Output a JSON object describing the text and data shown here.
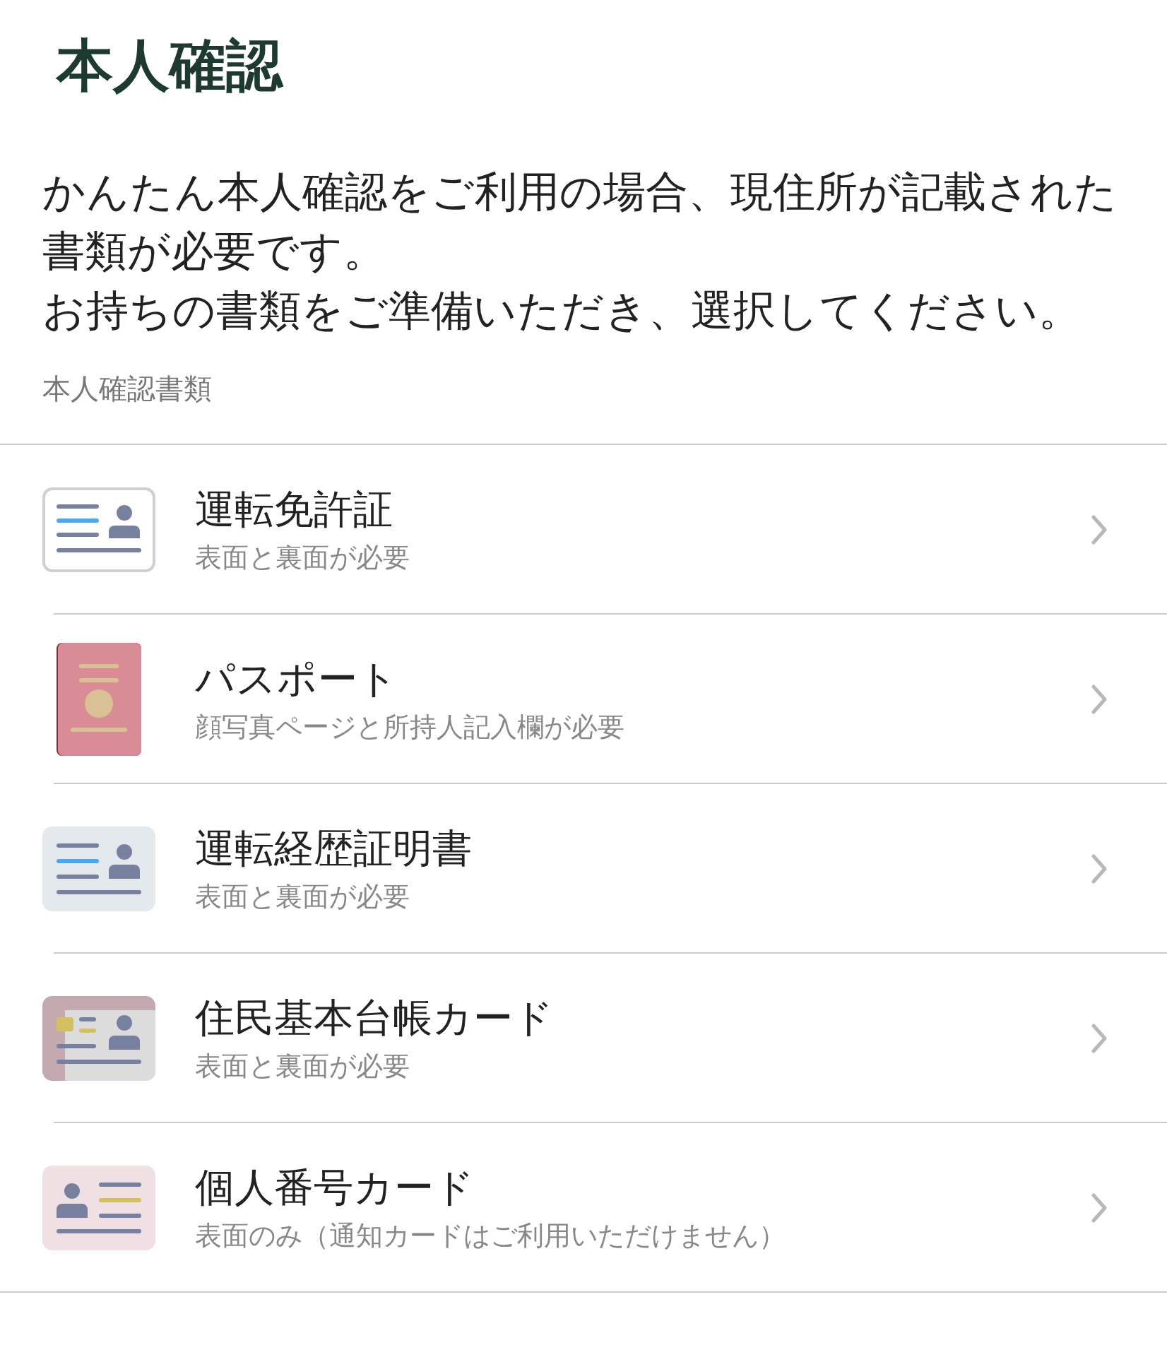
{
  "title": "本人確認",
  "description": [
    "かんたん本人確認をご利用の場合、現住所が記載された書類が必要です。",
    "お持ちの書類をご準備いただき、選択してください。"
  ],
  "section_label": "本人確認書類",
  "documents": [
    {
      "kind": "license",
      "name": "運転免許証",
      "note": "表面と裏面が必要"
    },
    {
      "kind": "passport",
      "name": "パスポート",
      "note": "顔写真ページと所持人記入欄が必要"
    },
    {
      "kind": "history",
      "name": "運転経歴証明書",
      "note": "表面と裏面が必要"
    },
    {
      "kind": "resident",
      "name": "住民基本台帳カード",
      "note": "表面と裏面が必要"
    },
    {
      "kind": "mynumber",
      "name": "個人番号カード",
      "note": "表面のみ（通知カードはご利用いただけません）"
    }
  ]
}
